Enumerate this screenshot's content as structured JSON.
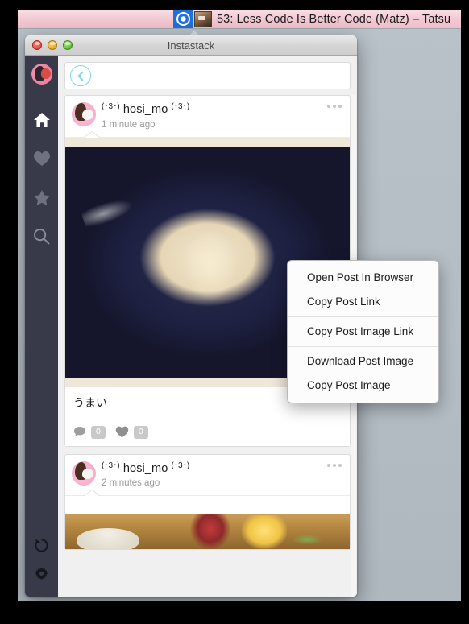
{
  "menubar": {
    "title": "53: Less Code Is Better Code (Matz) – Tatsu",
    "status_icon": "target-circle-icon",
    "thumbnail_icon": "video-thumbnail-icon"
  },
  "window": {
    "title": "Instastack",
    "traffic_lights": {
      "close_label": "close",
      "minimize_label": "minimize",
      "zoom_label": "zoom"
    }
  },
  "sidebar": {
    "avatar_icon": "user-avatar-icon",
    "items": [
      {
        "icon": "home-icon",
        "label": "Home",
        "active": true
      },
      {
        "icon": "heart-icon",
        "label": "Likes",
        "active": false
      },
      {
        "icon": "star-icon",
        "label": "Favorites",
        "active": false
      },
      {
        "icon": "search-icon",
        "label": "Search",
        "active": false
      }
    ],
    "bottom_items": [
      {
        "icon": "refresh-icon",
        "label": "Refresh"
      },
      {
        "icon": "gear-icon",
        "label": "Settings"
      }
    ],
    "colors": {
      "background": "#383a49",
      "active_icon": "#ffffff",
      "inactive_icon": "#6f7180",
      "bottom_icon": "#1b1c24"
    }
  },
  "topbar": {
    "back_icon": "chevron-left-circle-icon",
    "back_label": "Back",
    "accent_color": "#7fd4ef"
  },
  "feed": {
    "posts": [
      {
        "avatar_icon": "user-avatar-icon",
        "username": "hosi_mo",
        "kao_left": "(･3･)",
        "kao_right": "(･3･)",
        "timestamp": "1 minute ago",
        "overflow_icon": "more-dots-icon",
        "image_alt": "udon noodles on dark navy plate",
        "caption": "うまい",
        "comment_icon": "comment-bubble-icon",
        "comment_count": "0",
        "like_icon": "heart-icon",
        "like_count": "0"
      },
      {
        "avatar_icon": "user-avatar-icon",
        "username": "hosi_mo",
        "kao_left": "(･3･)",
        "kao_right": "(･3･)",
        "timestamp": "2 minutes ago",
        "overflow_icon": "more-dots-icon",
        "image_alt": "food on wooden counter"
      }
    ]
  },
  "context_menu": {
    "groups": [
      {
        "items": [
          "Open Post In Browser",
          "Copy Post Link"
        ]
      },
      {
        "items": [
          "Copy Post Image Link"
        ]
      },
      {
        "items": [
          "Download Post Image",
          "Copy Post Image"
        ]
      }
    ]
  },
  "desktop": {
    "background_color": "#b4bdc4"
  }
}
